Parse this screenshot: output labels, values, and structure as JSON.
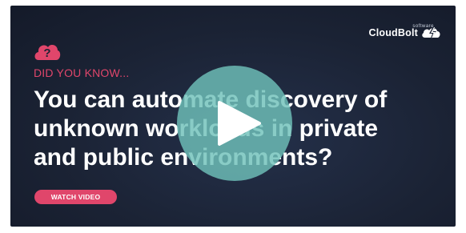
{
  "brand": {
    "name": "CloudBolt",
    "sub": "software"
  },
  "eyebrow": "DID YOU KNOW...",
  "headline": {
    "lines": [
      "You can automate discovery of",
      "unknown workloads in private",
      "and public environments?"
    ]
  },
  "cta": {
    "label": "WATCH VIDEO"
  },
  "colors": {
    "accent": "#e0466b",
    "card_bg": "#1b2335",
    "play_button": "#6fc1b9"
  },
  "icons": {
    "eyebrow_icon": "cloud-question-icon",
    "play_icon": "play-icon",
    "logo_icon": "cloudbolt-logo-icon"
  }
}
